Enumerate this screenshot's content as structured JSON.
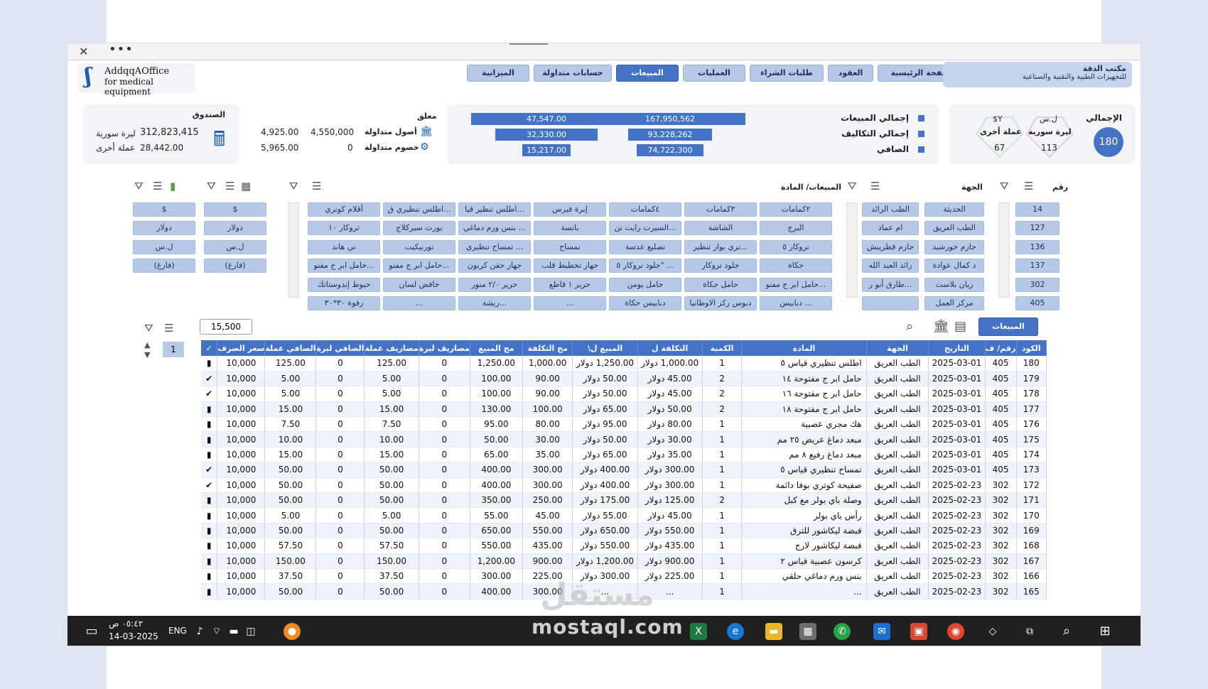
{
  "window": {
    "close_glyph": "✕",
    "more_glyph": "•••"
  },
  "logo": {
    "line1": "AddqqAOffice",
    "line2": "for medical equipment"
  },
  "brand": {
    "line1": "مكتب الدقة",
    "line2": "للتجهيزات الطبية والتقنية والصناعية"
  },
  "tabs": [
    "الصفحة الرئيسية",
    "العقود",
    "طلبات الشراء",
    "العمليات",
    "المبيعات",
    "حسابات متداولة",
    "الميزانية"
  ],
  "active_tab": "المبيعات",
  "totals_card": {
    "title": "الإجمالي",
    "count": "180",
    "syp_label": "ليرة سورية",
    "syp_count": "113",
    "syp_sym": "ل.س",
    "other_label": "عملة أخرى",
    "other_count": "67",
    "other_sym": "$Y"
  },
  "summary": {
    "sales_label": "إجمالي المبيعات",
    "costs_label": "إجمالي التكاليف",
    "net_label": "الصافي",
    "sales_syp": "167,950,562",
    "costs_syp": "93,228,262",
    "net_syp": "74,722,300",
    "sales_other": "47,547.00",
    "costs_other": "32,330.00",
    "net_other": "15,217.00",
    "sales_syp_frac": 1.0,
    "costs_syp_frac": 0.555,
    "net_syp_frac": 0.445,
    "sales_other_frac": 1.0,
    "costs_other_frac": 0.68,
    "net_other_frac": 0.32
  },
  "pending": {
    "title": "معلق",
    "assets_label": "أصول متداولة",
    "liab_label": "خصوم متداولة",
    "assets_v1": "4,550,000",
    "assets_v2": "4,925.00",
    "liab_v1": "0",
    "liab_v2": "5,965.00"
  },
  "cashbox": {
    "title": "الصندوق",
    "syp_value": "312,823,415",
    "syp_label": "ليرة سورية",
    "other_value": "28,442.00",
    "other_label": "عملة أخرى"
  },
  "slicers": {
    "num_title": "رقم",
    "party_title": "الجهة",
    "material_title": "المبيعات/ المادة",
    "nums": [
      "14",
      "127",
      "136",
      "137",
      "302",
      "405"
    ],
    "parties_col1": [
      "الحديثة",
      "الطب العريق",
      "حازم خورشيد",
      "د كمال عوادة",
      "ريان بلاست",
      "مركز العمل"
    ],
    "parties_col2": [
      "الطب الرائد",
      "ام عماد",
      "حازم قطريبش",
      "رائد العبد الله",
      "طارق أبو ر...",
      ""
    ],
    "materials": [
      [
        "٢كمامات",
        "٣كمامات",
        "٤كمامات",
        "إبرة فيرس",
        "اطلس تنظير قيا...",
        "اطلس تنظيري ق...",
        "أقلام كوتري"
      ],
      [
        "البرج",
        "الشاشة",
        "السيرت رايت تن...",
        "بانسة",
        "بنس ورم دماغي ...",
        "بورت سيركلاج",
        "تروكار ١٠"
      ],
      [
        "تروكار ٥",
        "تري بوار تنظير...",
        "تصليع عدسة",
        "تمساح",
        "تمساح تنظيري ...",
        "تورنيكيت",
        "تي هاند"
      ],
      [
        "جكاة",
        "جلود تروكار",
        "جلود تروكار ٥\" ...",
        "جهاز تخطيط قلب",
        "جهاز حقن كربون",
        "حامل ابر ج مفتو...",
        "حامل ابر ج مفتو..."
      ],
      [
        "حامل ابر ج مفتو...",
        "حامل جكاة",
        "حامل يومن",
        "حرير ١ قاطع",
        "حرير ٢/٠ منور",
        "خافض لسان",
        "خيوط إندوستاتك"
      ],
      [
        "دبابيس ...",
        "دبوس ركز الاوطانيا",
        "دبابيس حكاة",
        "...",
        "ريشة...",
        "...",
        "رفوة ٣٠*٣٠"
      ]
    ],
    "currency1": [
      "$",
      "دولار",
      "ل.س",
      "(فارغ)"
    ],
    "currency2": [
      "$",
      "دولار",
      "ل.س",
      "(فارغ)"
    ]
  },
  "table_section": {
    "title": "المبيعات",
    "tooltip_value": "15,500",
    "spinner_value": "1"
  },
  "table": {
    "headers": [
      "الكود",
      "رقم/ ف",
      "التاريخ",
      "الجهة",
      "المادة",
      "الكمية",
      "التكلفة ل",
      "المبيع ل\\",
      "مج التكلفة",
      "مج المبيع",
      "مصاريف ليرة",
      "مصاريف عملة",
      "الصافي ليرة",
      "الصافي عملة",
      "سعر الصرف",
      "✓"
    ],
    "rows": [
      [
        "180",
        "405",
        "2025-03-01",
        "الطب العريق",
        "اطلس تنظيري قياس ٥",
        "1",
        "1,000.00 دولار",
        "1,250.00 دولار",
        "1,000.00",
        "1,250.00",
        "0",
        "125.00",
        "0",
        "125.00",
        "10,000",
        "warn"
      ],
      [
        "179",
        "405",
        "2025-03-01",
        "الطب العريق",
        "حامل ابر ج مفتوحة ١٤",
        "2",
        "45.00 دولار",
        "50.00 دولار",
        "90.00",
        "100.00",
        "0",
        "5.00",
        "0",
        "5.00",
        "10,000",
        "ok"
      ],
      [
        "178",
        "405",
        "2025-03-01",
        "الطب العريق",
        "حامل ابر ج مفتوحة ١٦",
        "2",
        "45.00 دولار",
        "50.00 دولار",
        "90.00",
        "100.00",
        "0",
        "5.00",
        "0",
        "5.00",
        "10,000",
        "ok"
      ],
      [
        "177",
        "405",
        "2025-03-01",
        "الطب العريق",
        "حامل ابر ج مفتوحة ١٨",
        "2",
        "50.00 دولار",
        "65.00 دولار",
        "100.00",
        "130.00",
        "0",
        "15.00",
        "0",
        "15.00",
        "10,000",
        "warn"
      ],
      [
        "176",
        "405",
        "2025-03-01",
        "الطب العريق",
        "هك مجري عصبية",
        "1",
        "80.00 دولار",
        "95.00 دولار",
        "80.00",
        "95.00",
        "0",
        "7.50",
        "0",
        "7.50",
        "10,000",
        "warn"
      ],
      [
        "175",
        "405",
        "2025-03-01",
        "الطب العريق",
        "مبعد دماغ عريض ٢٥ مم",
        "1",
        "30.00 دولار",
        "50.00 دولار",
        "30.00",
        "50.00",
        "0",
        "10.00",
        "0",
        "10.00",
        "10,000",
        "warn"
      ],
      [
        "174",
        "405",
        "2025-03-01",
        "الطب العريق",
        "مبعد دماغ رفيع ٨ مم",
        "1",
        "35.00 دولار",
        "65.00 دولار",
        "35.00",
        "65.00",
        "0",
        "15.00",
        "0",
        "15.00",
        "10,000",
        "warn"
      ],
      [
        "173",
        "405",
        "2025-03-01",
        "الطب العريق",
        "تمساح تنظيري قياس ٥",
        "1",
        "300.00 دولار",
        "400.00 دولار",
        "300.00",
        "400.00",
        "0",
        "50.00",
        "0",
        "50.00",
        "10,000",
        "ok"
      ],
      [
        "172",
        "302",
        "2025-02-23",
        "الطب العريق",
        "صفيحة كوتري بوفا دائمة",
        "1",
        "300.00 دولار",
        "400.00 دولار",
        "300.00",
        "400.00",
        "0",
        "50.00",
        "0",
        "50.00",
        "10,000",
        "ok"
      ],
      [
        "171",
        "302",
        "2025-02-23",
        "الطب العريق",
        "وصلة باي بولر مع كبل",
        "2",
        "125.00 دولار",
        "175.00 دولار",
        "250.00",
        "350.00",
        "0",
        "50.00",
        "0",
        "50.00",
        "10,000",
        "warn"
      ],
      [
        "170",
        "302",
        "2025-02-23",
        "الطب العريق",
        "رأس باي بولر",
        "1",
        "45.00 دولار",
        "55.00 دولار",
        "45.00",
        "55.00",
        "0",
        "5.00",
        "0",
        "5.00",
        "10,000",
        "warn"
      ],
      [
        "169",
        "302",
        "2025-02-23",
        "الطب العريق",
        "قبضة ليكاشور للترق",
        "1",
        "550.00 دولار",
        "650.00 دولار",
        "550.00",
        "650.00",
        "0",
        "50.00",
        "0",
        "50.00",
        "10,000",
        "warn"
      ],
      [
        "168",
        "302",
        "2025-02-23",
        "الطب العريق",
        "قبضة ليكاشور  لارج",
        "1",
        "435.00 دولار",
        "550.00 دولار",
        "435.00",
        "550.00",
        "0",
        "57.50",
        "0",
        "57.50",
        "10,000",
        "warn"
      ],
      [
        "167",
        "302",
        "2025-02-23",
        "الطب العريق",
        "كرسون عصبية قياس ٢",
        "1",
        "900.00 دولار",
        "1,200.00 دولار",
        "900.00",
        "1,200.00",
        "0",
        "150.00",
        "0",
        "150.00",
        "10,000",
        "warn"
      ],
      [
        "166",
        "302",
        "2025-02-23",
        "الطب العريق",
        "بنس ورم دماغي حلقي",
        "1",
        "225.00 دولار",
        "300.00 دولار",
        "225.00",
        "300.00",
        "0",
        "37.50",
        "0",
        "37.50",
        "10,000",
        "warn"
      ],
      [
        "165",
        "302",
        "2025-02-23",
        "الطب العريق",
        "...",
        "1",
        "...",
        "...",
        "300.00",
        "400.00",
        "0",
        "50.00",
        "0",
        "50.00",
        "10,000",
        "warn"
      ]
    ]
  },
  "taskbar": {
    "time": "٠٥:٤٢ ص",
    "date": "14-03-2025",
    "lang": "ENG"
  },
  "watermark": {
    "arabic": "مستقل",
    "latin": "mostaql.com"
  }
}
